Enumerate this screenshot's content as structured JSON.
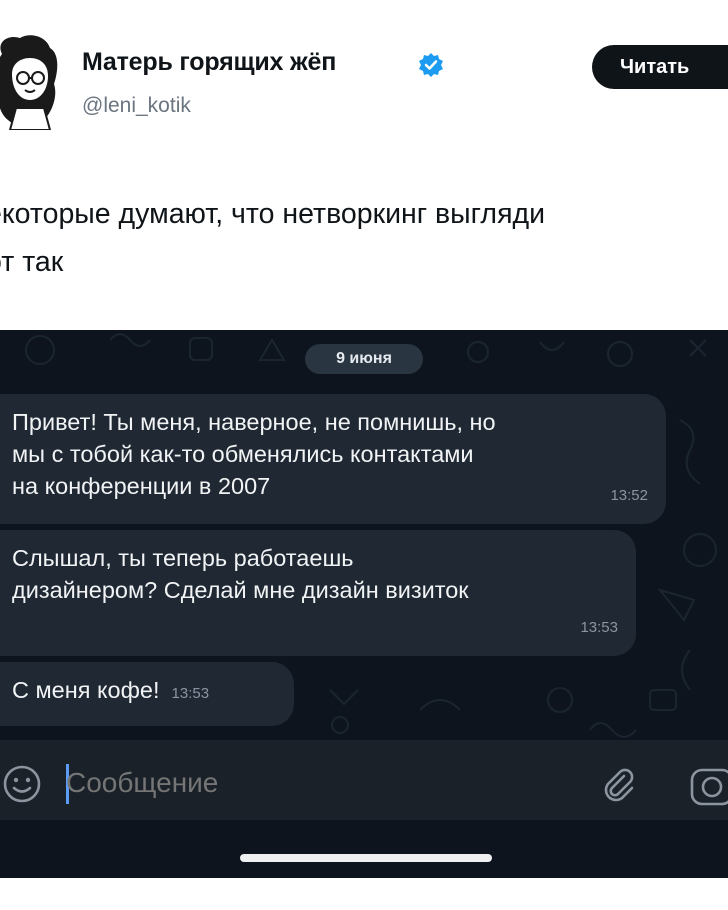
{
  "tweet": {
    "author_name": "Матерь горящих жёп",
    "handle": "@leni_kotik",
    "follow_label": "Читать",
    "text_line1": "екоторые думают, что нетворкинг выгляди",
    "text_line2": "от так"
  },
  "chat": {
    "date": "9 июня",
    "messages": [
      {
        "line1": "Привет! Ты меня, наверное, не помнишь, но",
        "line2": "мы с тобой как-то обменялись контактами",
        "line3": "на конференции в 2007",
        "time": "13:52"
      },
      {
        "line1": "Слышал, ты теперь работаешь",
        "line2": "дизайнером? Сделай мне дизайн визиток",
        "time": "13:53"
      },
      {
        "line1": "С меня кофе!",
        "time": "13:53"
      }
    ],
    "input_placeholder": "Сообщение"
  },
  "colors": {
    "follow_button": "#0f1419",
    "verified_badge": "#1d9bf0",
    "chat_background": "#0d141d",
    "bubble": "#1f2833",
    "cursor": "#5b9cf5"
  },
  "icons": [
    "avatar-illustration",
    "verified-badge-icon",
    "emoji-icon",
    "paperclip-icon",
    "camera-icon"
  ]
}
